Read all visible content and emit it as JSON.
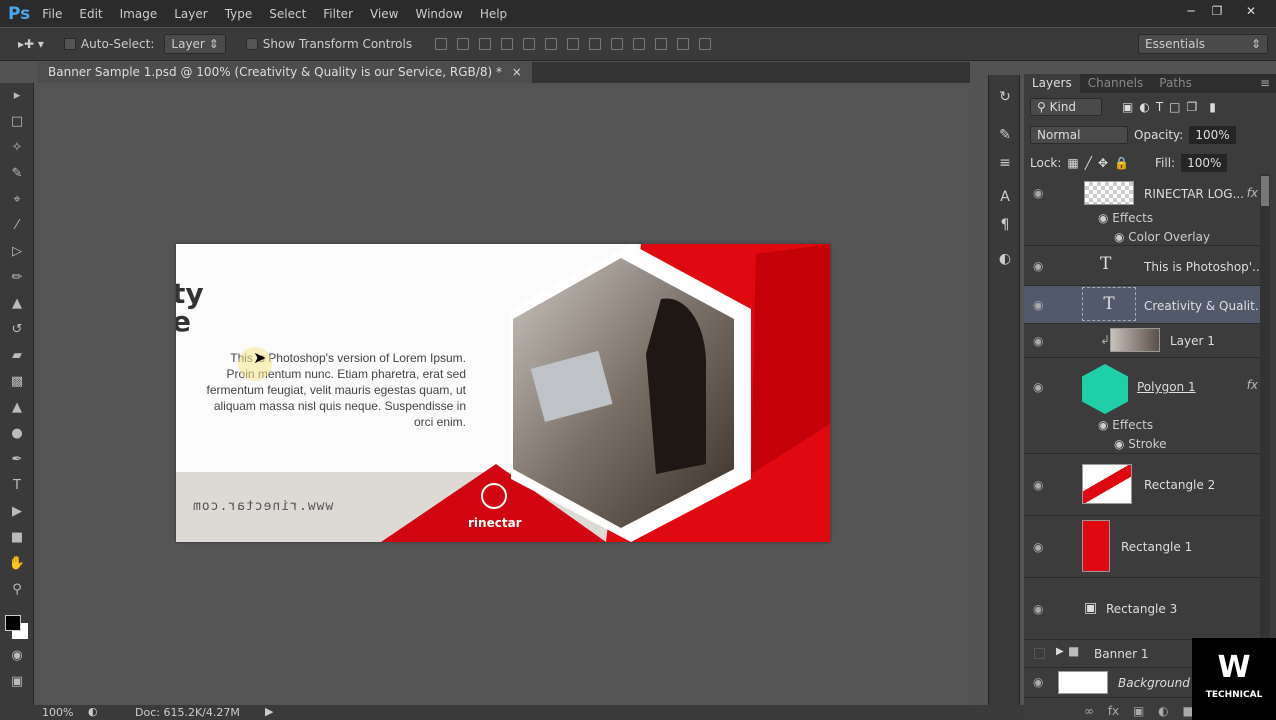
{
  "app": {
    "logo": "Ps",
    "menu": [
      "File",
      "Edit",
      "Image",
      "Layer",
      "Type",
      "Select",
      "Filter",
      "View",
      "Window",
      "Help"
    ]
  },
  "options": {
    "auto_select_label": "Auto-Select:",
    "auto_select_value": "Layer",
    "show_transform_label": "Show Transform Controls",
    "workspace": "Essentials"
  },
  "document": {
    "tab_title": "Banner Sample 1.psd @ 100% (Creativity & Quality is our Service, RGB/8) *",
    "close": "×"
  },
  "banner": {
    "heading_line1": "ty",
    "heading_line2": "e",
    "body_lines": [
      "This is Photoshop's version  of Lorem Ipsum.",
      "Proin mentum nunc. Etiam pharetra, erat sed",
      "fermentum feugiat, velit mauris egestas quam, ut",
      "aliquam massa nisl quis neque. Suspendisse in",
      "orci enim."
    ],
    "url": "www.rinectar.com",
    "logo_text": "rinectar",
    "colors": {
      "red": "#e0090f",
      "dark_red": "#c40008",
      "teal": "#1fcfa8"
    }
  },
  "status": {
    "zoom": "100%",
    "doc": "Doc: 615.2K/4.27M"
  },
  "layers_panel": {
    "tabs": [
      "Layers",
      "Channels",
      "Paths"
    ],
    "filter": "Kind",
    "blend_mode": "Normal",
    "opacity_label": "Opacity:",
    "opacity": "100%",
    "lock_label": "Lock:",
    "fill_label": "Fill:",
    "fill": "100%",
    "layers": [
      {
        "name": "RINECTAR LOG...",
        "fx": "fx",
        "effects_label": "Effects",
        "effects": [
          "Color Overlay"
        ]
      },
      {
        "name": "This is Photoshop'..."
      },
      {
        "name": "Creativity & Qualit..."
      },
      {
        "name": "Layer 1"
      },
      {
        "name": "Polygon 1",
        "fx": "fx",
        "effects_label": "Effects",
        "effects": [
          "Stroke"
        ]
      },
      {
        "name": "Rectangle 2"
      },
      {
        "name": "Rectangle 1"
      },
      {
        "name": "Rectangle 3"
      },
      {
        "name": "Banner 1"
      },
      {
        "name": "Background"
      }
    ]
  },
  "watermark": {
    "text": "TECHNICAL"
  }
}
